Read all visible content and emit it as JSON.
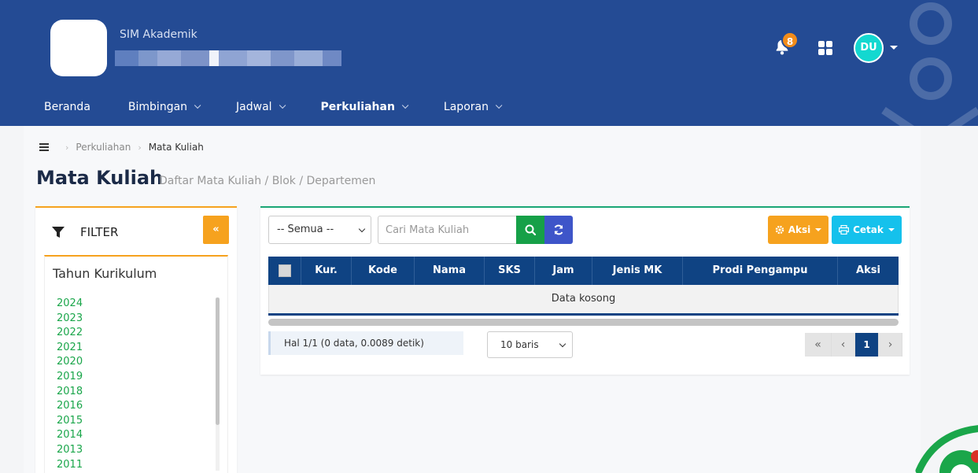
{
  "header": {
    "app_name": "SIM Akademik",
    "notification_count": "8",
    "avatar_initials": "DU",
    "colors": {
      "primary": "#244b94",
      "badge": "#f28c1a",
      "avatar": "#13d8d0"
    }
  },
  "nav": {
    "items": [
      {
        "label": "Beranda"
      },
      {
        "label": "Bimbingan"
      },
      {
        "label": "Jadwal"
      },
      {
        "label": "Perkuliahan"
      },
      {
        "label": "Laporan"
      }
    ]
  },
  "breadcrumb": {
    "parent": "Perkuliahan",
    "current": "Mata Kuliah"
  },
  "page": {
    "title": "Mata Kuliah",
    "subtitle": "Daftar Mata Kuliah / Blok / Departemen"
  },
  "filter": {
    "heading": "FILTER",
    "collapse_label": "«",
    "section_title": "Tahun Kurikulum",
    "years": [
      "2024",
      "2023",
      "2022",
      "2021",
      "2020",
      "2019",
      "2018",
      "2016",
      "2015",
      "2014",
      "2013",
      "2011"
    ]
  },
  "toolbar": {
    "select_value": "-- Semua --",
    "search_placeholder": "Cari Mata Kuliah",
    "aksi_label": "Aksi",
    "cetak_label": "Cetak"
  },
  "table": {
    "columns": [
      "Kur.",
      "Kode",
      "Nama",
      "SKS",
      "Jam",
      "Jenis MK",
      "Prodi Pengampu",
      "Aksi"
    ],
    "empty_text": "Data kosong"
  },
  "footer": {
    "info": "Hal 1/1 (0 data, 0.0089 detik)",
    "rows_per_page": "10 baris",
    "pager": {
      "first": "«",
      "prev": "‹",
      "current": "1",
      "next": "›"
    }
  }
}
